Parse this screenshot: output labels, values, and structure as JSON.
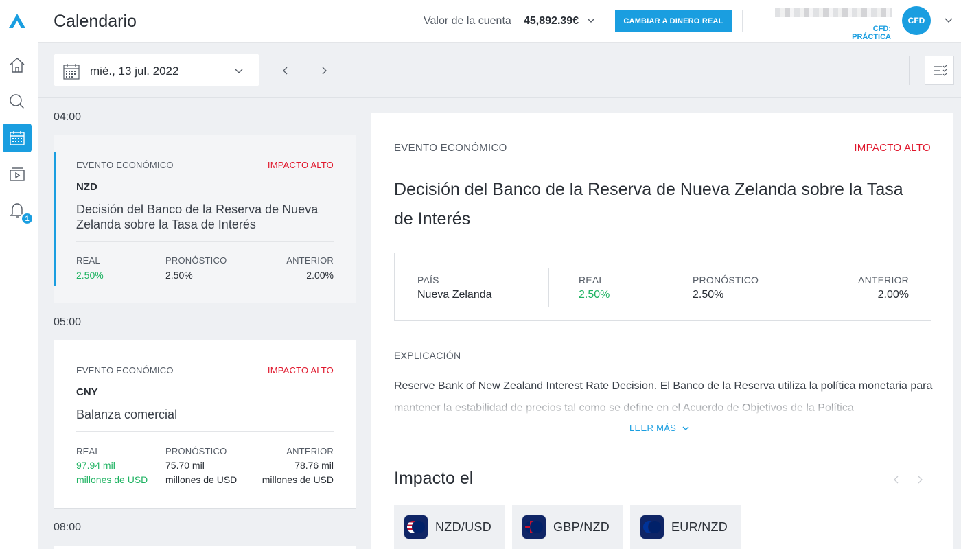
{
  "header": {
    "title": "Calendario",
    "account_label": "Valor de la cuenta",
    "account_value": "45,892.39€",
    "real_money_button": "CAMBIAR A DINERO REAL",
    "account_type": "CFD: PRÁCTICA",
    "avatar_text": "CFD"
  },
  "sidebar": {
    "items": [
      {
        "icon": "home-icon"
      },
      {
        "icon": "search-icon"
      },
      {
        "icon": "calendar-icon",
        "active": true
      },
      {
        "icon": "video-icon"
      },
      {
        "icon": "bell-icon",
        "badge": "1"
      }
    ]
  },
  "toolbar": {
    "date": "mié., 13 jul. 2022"
  },
  "events": [
    {
      "time": "04:00",
      "type": "EVENTO ECONÓMICO",
      "impact": "IMPACTO ALTO",
      "currency": "NZD",
      "title": "Decisión del Banco de la Reserva de Nueva Zelanda sobre la Tasa de Interés",
      "real_label": "REAL",
      "forecast_label": "PRONÓSTICO",
      "previous_label": "ANTERIOR",
      "real": "2.50%",
      "forecast": "2.50%",
      "previous": "2.00%"
    },
    {
      "time": "05:00",
      "type": "EVENTO ECONÓMICO",
      "impact": "IMPACTO ALTO",
      "currency": "CNY",
      "title": "Balanza comercial",
      "real_label": "REAL",
      "forecast_label": "PRONÓSTICO",
      "previous_label": "ANTERIOR",
      "real_1": "97.94 mil",
      "real_2": "millones de USD",
      "forecast_1": "75.70 mil",
      "forecast_2": "millones de USD",
      "previous_1": "78.76 mil",
      "previous_2": "millones de USD"
    },
    {
      "time": "08:00"
    }
  ],
  "detail": {
    "type": "EVENTO ECONÓMICO",
    "impact": "IMPACTO ALTO",
    "title": "Decisión del Banco de la Reserva de Nueva Zelanda sobre la Tasa de Interés",
    "country_label": "PAÍS",
    "country": "Nueva Zelanda",
    "real_label": "REAL",
    "real": "2.50%",
    "forecast_label": "PRONÓSTICO",
    "forecast": "2.50%",
    "previous_label": "ANTERIOR",
    "previous": "2.00%",
    "explanation_label": "EXPLICACIÓN",
    "explanation": "Reserve Bank of New Zealand Interest Rate Decision. El Banco de la Reserva utiliza la política monetaria para mantener la estabilidad de precios tal como se define en el Acuerdo de Objetivos de la Política",
    "read_more": "LEER MÁS",
    "impact_title": "Impacto el",
    "pairs": [
      {
        "label": "NZD/USD",
        "flag": "nz-us-flag-icon"
      },
      {
        "label": "GBP/NZD",
        "flag": "gb-nz-flag-icon"
      },
      {
        "label": "EUR/NZD",
        "flag": "eu-nz-flag-icon"
      }
    ]
  },
  "colors": {
    "accent": "#1a9ee0",
    "impact_high": "#e0182d",
    "positive": "#1fb362"
  }
}
